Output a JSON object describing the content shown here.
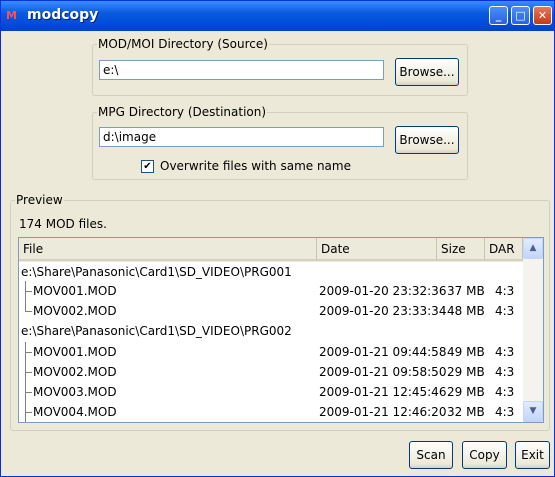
{
  "window": {
    "app_icon_text": "M",
    "title": "modcopy",
    "controls": {
      "minimize": "_",
      "maximize": "□",
      "close": "✕"
    }
  },
  "source": {
    "legend": "MOD/MOI Directory (Source)",
    "value": "e:\\",
    "browse_label": "Browse..."
  },
  "destination": {
    "legend": "MPG Directory (Destination)",
    "value": "d:\\image",
    "browse_label": "Browse...",
    "overwrite_label": "Overwrite files with same name",
    "overwrite_checked": true,
    "check_mark": "✔"
  },
  "preview": {
    "legend": "Preview",
    "count_text": "174 MOD files.",
    "columns": [
      "File",
      "Date",
      "Size",
      "DAR"
    ],
    "rows": [
      {
        "type": "folder",
        "path": "e:\\Share\\Panasonic\\Card1\\SD_VIDEO\\PRG001"
      },
      {
        "type": "file",
        "name": "MOV001.MOD",
        "date": "2009-01-20 23:32:36",
        "size": "37 MB",
        "dar": "4:3"
      },
      {
        "type": "file",
        "name": "MOV002.MOD",
        "date": "2009-01-20 23:33:34",
        "size": "48 MB",
        "dar": "4:3"
      },
      {
        "type": "folder",
        "path": "e:\\Share\\Panasonic\\Card1\\SD_VIDEO\\PRG002"
      },
      {
        "type": "file",
        "name": "MOV001.MOD",
        "date": "2009-01-21 09:44:58",
        "size": "49 MB",
        "dar": "4:3"
      },
      {
        "type": "file",
        "name": "MOV002.MOD",
        "date": "2009-01-21 09:58:50",
        "size": "29 MB",
        "dar": "4:3"
      },
      {
        "type": "file",
        "name": "MOV003.MOD",
        "date": "2009-01-21 12:45:46",
        "size": "29 MB",
        "dar": "4:3"
      },
      {
        "type": "file",
        "name": "MOV004.MOD",
        "date": "2009-01-21 12:46:20",
        "size": "32 MB",
        "dar": "4:3"
      }
    ],
    "scroll_up": "▲",
    "scroll_down": "▼"
  },
  "actions": {
    "scan": "Scan",
    "copy": "Copy",
    "exit": "Exit"
  }
}
